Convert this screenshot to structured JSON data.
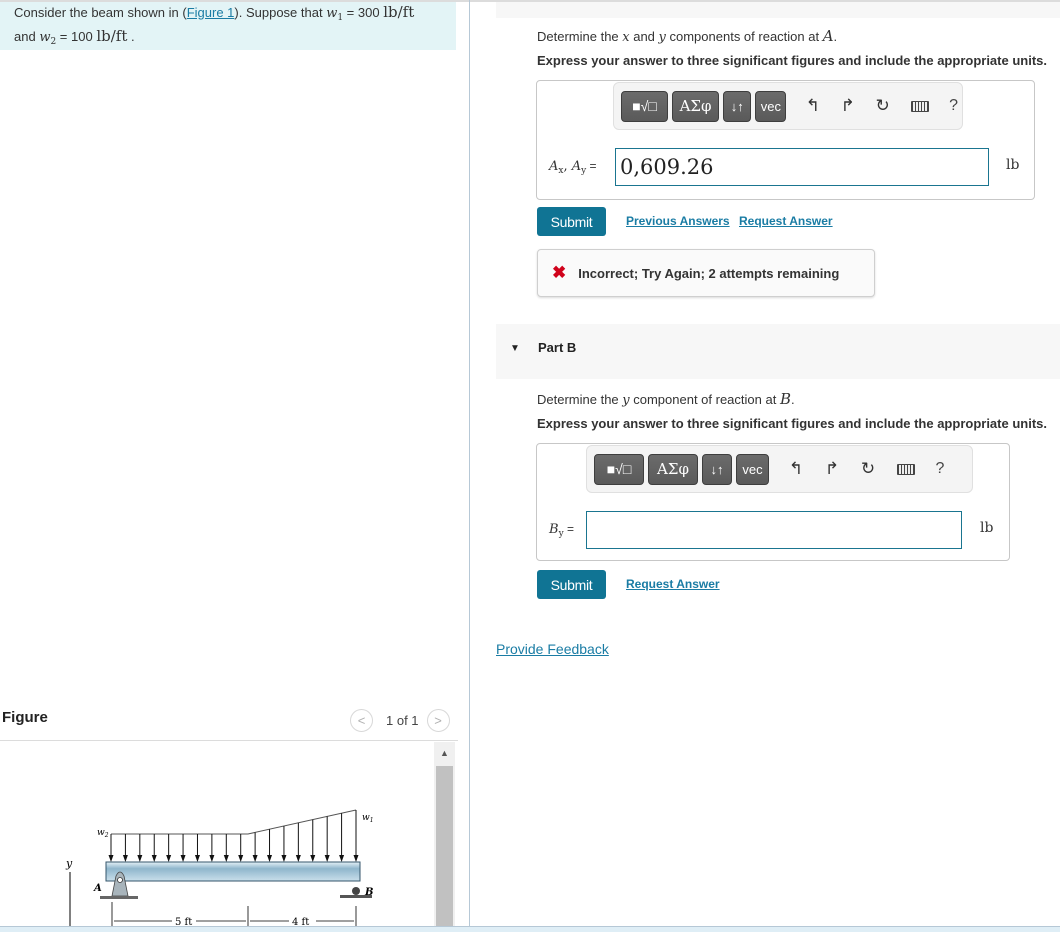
{
  "problem": {
    "text_before_link": "Consider the beam shown in (",
    "figure_link": "Figure 1",
    "text_after_link": "). Suppose that ",
    "w1_symbol": "w",
    "w1_sub": "1",
    "w1_value": " = 300 ",
    "w1_unit": "lb/ft",
    "and": "and ",
    "w2_symbol": "w",
    "w2_sub": "2",
    "w2_value": " = 100 ",
    "w2_unit": "lb/ft",
    "end": " ."
  },
  "toolbar": {
    "template_label": "■√□",
    "greek_label": "ΑΣφ",
    "arrows_label": "↓↑",
    "vec_label": "vec",
    "undo_icon": "↰",
    "redo_icon": "↱",
    "reset_icon": "↻",
    "help_label": "?"
  },
  "partA": {
    "question_pre": "Determine the ",
    "var_x": "x",
    "mid": " and ",
    "var_y": "y",
    "post": " components of reaction at ",
    "point": "A",
    "dot": ".",
    "instruction": "Express your answer to three significant figures and include the appropriate units.",
    "label": "Ax, Ay",
    "label_A1": "A",
    "label_sub1": "x",
    "label_A2": "A",
    "label_sub2": "y",
    "equals": " =",
    "answer_value": "0,609.26",
    "unit": "lb",
    "submit_label": "Submit",
    "previous_answers_label": "Previous Answers",
    "request_answer_label": "Request Answer",
    "feedback_icon": "✖",
    "feedback_text": "Incorrect; Try Again; 2 attempts remaining"
  },
  "partB": {
    "title": "Part B",
    "caret": "▼",
    "question_pre": "Determine the ",
    "var_y": "y",
    "post": " component of reaction at ",
    "point": "B",
    "dot": ".",
    "instruction": "Express your answer to three significant figures and include the appropriate units.",
    "label_B": "B",
    "label_sub": "y",
    "equals": " =",
    "answer_value": "",
    "unit": "lb",
    "submit_label": "Submit",
    "request_answer_label": "Request Answer"
  },
  "provide_feedback_label": "Provide Feedback",
  "figure": {
    "title": "Figure",
    "pager_text": "1 of 1",
    "prev_icon": "<",
    "next_icon": ">",
    "labels": {
      "w1": "w",
      "w1_sub": "1",
      "w2": "w",
      "w2_sub": "2",
      "y_axis": "y",
      "A": "A",
      "B": "B",
      "dim1": "5 ft",
      "dim2": "4 ft"
    }
  }
}
